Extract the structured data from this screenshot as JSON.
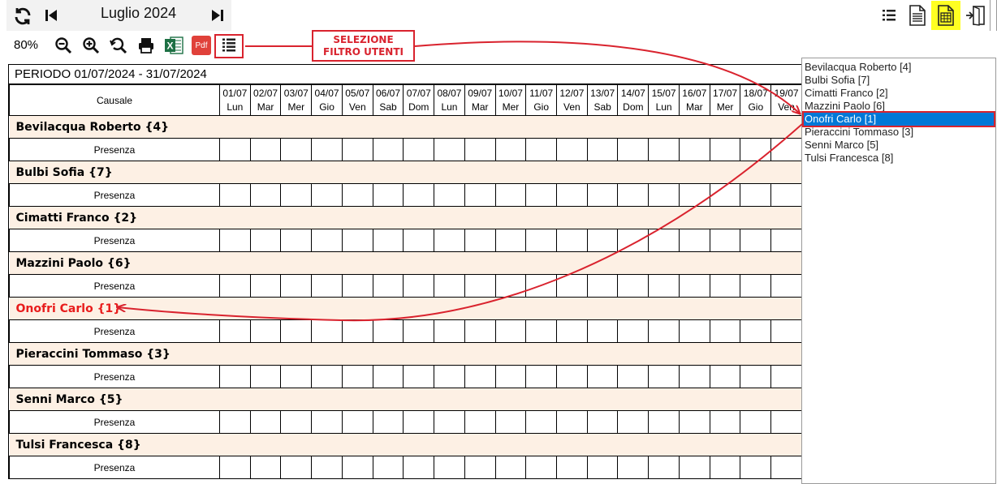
{
  "header": {
    "month_title": "Luglio 2024",
    "icons": [
      "refresh-icon",
      "first-icon",
      "last-icon",
      "list-view-icon",
      "document-icon",
      "spreadsheet-icon",
      "exit-icon"
    ]
  },
  "toolbar": {
    "zoom_level": "80%",
    "excel_label": "X",
    "pdf_label": "Pdf"
  },
  "callout": {
    "line1": "SELEZIONE",
    "line2": "FILTRO UTENTI"
  },
  "grid": {
    "period": "PERIODO 01/07/2024 - 31/07/2024",
    "causale_header": "Causale",
    "row_label": "Presenza",
    "days": [
      {
        "date": "01/07",
        "dow": "Lun"
      },
      {
        "date": "02/07",
        "dow": "Mar"
      },
      {
        "date": "03/07",
        "dow": "Mer"
      },
      {
        "date": "04/07",
        "dow": "Gio"
      },
      {
        "date": "05/07",
        "dow": "Ven"
      },
      {
        "date": "06/07",
        "dow": "Sab"
      },
      {
        "date": "07/07",
        "dow": "Dom"
      },
      {
        "date": "08/07",
        "dow": "Lun"
      },
      {
        "date": "09/07",
        "dow": "Mar"
      },
      {
        "date": "10/07",
        "dow": "Mer"
      },
      {
        "date": "11/07",
        "dow": "Gio"
      },
      {
        "date": "12/07",
        "dow": "Ven"
      },
      {
        "date": "13/07",
        "dow": "Sab"
      },
      {
        "date": "14/07",
        "dow": "Dom"
      },
      {
        "date": "15/07",
        "dow": "Lun"
      },
      {
        "date": "16/07",
        "dow": "Mar"
      },
      {
        "date": "17/07",
        "dow": "Mer"
      },
      {
        "date": "18/07",
        "dow": "Gio"
      },
      {
        "date": "19/07",
        "dow": "Ven"
      }
    ],
    "users": [
      {
        "name": "Bevilacqua Roberto {4}",
        "selected": false
      },
      {
        "name": "Bulbi Sofia {7}",
        "selected": false
      },
      {
        "name": "Cimatti Franco {2}",
        "selected": false
      },
      {
        "name": "Mazzini Paolo {6}",
        "selected": false
      },
      {
        "name": "Onofri Carlo {1}",
        "selected": true
      },
      {
        "name": "Pieraccini Tommaso {3}",
        "selected": false
      },
      {
        "name": "Senni Marco {5}",
        "selected": false
      },
      {
        "name": "Tulsi Francesca {8}",
        "selected": false
      }
    ]
  },
  "user_list": {
    "items": [
      {
        "label": "Bevilacqua Roberto [4]",
        "selected": false
      },
      {
        "label": "Bulbi Sofia [7]",
        "selected": false
      },
      {
        "label": "Cimatti Franco [2]",
        "selected": false
      },
      {
        "label": "Mazzini Paolo [6]",
        "selected": false
      },
      {
        "label": "Onofri Carlo [1]",
        "selected": true
      },
      {
        "label": "Pieraccini Tommaso [3]",
        "selected": false
      },
      {
        "label": "Senni Marco [5]",
        "selected": false
      },
      {
        "label": "Tulsi Francesca [8]",
        "selected": false
      }
    ]
  },
  "colors": {
    "user_row_bg": "#fdf0e4",
    "accent_red": "#d9232e",
    "selection_blue": "#0078d7",
    "highlight_yellow": "#ffff22",
    "excel_green": "#1d7044",
    "pdf_red": "#e0413a"
  }
}
